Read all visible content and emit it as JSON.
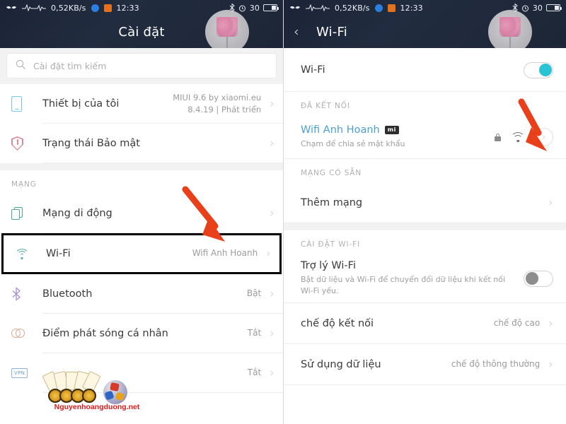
{
  "statusbar": {
    "speed": "0,52KB/s",
    "time": "12:33",
    "battery_percent": "30",
    "icons": [
      "wings-icon",
      "pulse-icon",
      "pulse-icon-2",
      "messenger-icon",
      "app-icon",
      "bluetooth-icon",
      "alarm-icon",
      "battery-icon"
    ]
  },
  "left": {
    "title": "Cài đặt",
    "search": {
      "placeholder": "Cài đặt tìm kiếm"
    },
    "rows_top": [
      {
        "label": "Thiết bị của tôi",
        "value": "MIUI 9.6 by xiaomi.eu\n8.4.19 | Phát triển",
        "icon": "phone-icon"
      },
      {
        "label": "Trạng thái Bảo mật",
        "value": "",
        "icon": "shield-icon"
      }
    ],
    "group_network": "MẠNG",
    "rows_network": [
      {
        "label": "Mạng di động",
        "value": "",
        "icon": "sim-icon"
      }
    ],
    "highlighted_row": {
      "label": "Wi-Fi",
      "value": "Wifi Anh Hoanh",
      "icon": "wifi-icon"
    },
    "rows_bottom": [
      {
        "label": "Bluetooth",
        "value": "Bật",
        "icon": "bluetooth-icon"
      },
      {
        "label": "Điểm phát sóng cá nhân",
        "value": "Tắt",
        "icon": "hotspot-rings-icon"
      },
      {
        "label": "",
        "value": "Tắt",
        "icon": "vpn-icon"
      }
    ],
    "vpn_badge_text": "VPN"
  },
  "right": {
    "title": "Wi-Fi",
    "back": "back-chevron-icon",
    "wifi_toggle": {
      "label": "Wi-Fi",
      "state": "on"
    },
    "group_connected": "ĐÃ KẾT NỐI",
    "connected": {
      "name": "Wifi Anh Hoanh",
      "badge": "mi",
      "subtitle": "Chạm để chia sẻ mật khẩu",
      "icons": [
        "lock-icon",
        "wifi-signal-icon",
        "circle-chevron-icon"
      ]
    },
    "group_available": "MẠNG CÓ SẴN",
    "add_network": {
      "label": "Thêm mạng"
    },
    "group_settings": "CÀI ĐẶT WI-FI",
    "assistant": {
      "label": "Trợ lý Wi-Fi",
      "subtitle": "Bật dữ liệu và Wi-Fi để chuyển đổi dữ liệu khi kết nối Wi-Fi yếu.",
      "state": "off"
    },
    "rows_settings": [
      {
        "label": "chế độ kết nối",
        "value": "chế độ cao"
      },
      {
        "label": "Sử dụng dữ liệu",
        "value": "chế độ thông thường"
      }
    ]
  },
  "annotations": {
    "arrow_color": "#E8401A",
    "highlight_box_color": "#000000"
  },
  "watermark": {
    "text": "Nguyenhoangduong.net",
    "color": "#e01a1a"
  }
}
